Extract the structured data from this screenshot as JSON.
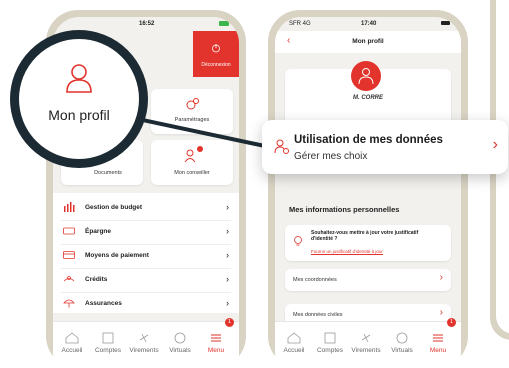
{
  "left_phone": {
    "status_time": "16:52",
    "logout_label": "Déconnexion",
    "tiles": {
      "parametrages": "Paramétrages",
      "documents": "Documents",
      "mon_conseiller": "Mon conseiller"
    },
    "menu_items": [
      {
        "label": "Gestion de budget",
        "icon": "budget-icon"
      },
      {
        "label": "Épargne",
        "icon": "savings-icon"
      },
      {
        "label": "Moyens de paiement",
        "icon": "card-icon"
      },
      {
        "label": "Crédits",
        "icon": "loan-icon"
      },
      {
        "label": "Assurances",
        "icon": "umbrella-icon"
      }
    ]
  },
  "zoom_profile": {
    "label": "Mon profil"
  },
  "right_phone": {
    "status_carrier": "SFR 4G",
    "status_time": "17:40",
    "nav_title": "Mon profil",
    "user_name": "M. CORRE",
    "section_title": "Mes informations personnelles",
    "identity_prompt": "Souhaitez-vous mettre à jour votre justificatif d'identité ?",
    "identity_link": "Fournir un justificatif d'identité à jour",
    "rows": {
      "coordonnees": "Mes coordonnées",
      "donnees_civiles": "Mes données civiles"
    }
  },
  "callout": {
    "title": "Utilisation de mes données",
    "subtitle": "Gérer mes choix"
  },
  "tabbar": {
    "items": [
      "Accueil",
      "Comptes",
      "Virements",
      "Virtuals",
      "Menu"
    ],
    "badge": "1"
  },
  "colors": {
    "accent": "#e2342c",
    "frame": "#d8d3c3",
    "ring": "#1c2a33"
  }
}
